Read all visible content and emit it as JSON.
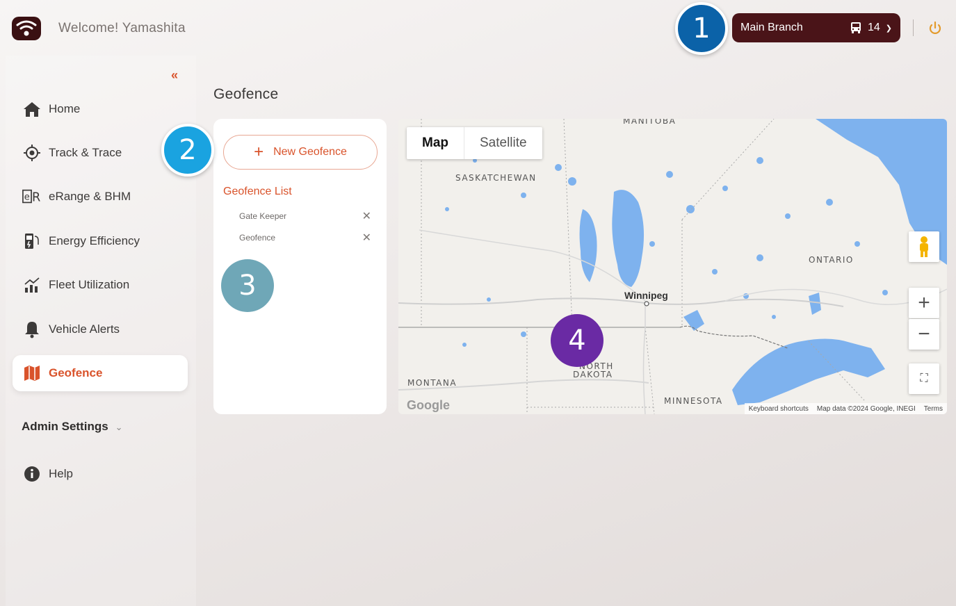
{
  "header": {
    "welcome": "Welcome! Yamashita",
    "branch": "Main Branch",
    "vehicle_count": "14"
  },
  "badges": [
    "1",
    "2",
    "3",
    "4"
  ],
  "sidebar": {
    "items": [
      {
        "label": "Home",
        "icon": "home-icon"
      },
      {
        "label": "Track & Trace",
        "icon": "crosshair-icon"
      },
      {
        "label": "eRange & BHM",
        "icon": "erange-icon"
      },
      {
        "label": "Energy Efficiency",
        "icon": "charger-icon"
      },
      {
        "label": "Fleet Utilization",
        "icon": "chart-icon"
      },
      {
        "label": "Vehicle Alerts",
        "icon": "bell-icon"
      },
      {
        "label": "Geofence",
        "icon": "map-icon",
        "active": true
      }
    ],
    "admin_settings": "Admin Settings",
    "help": "Help"
  },
  "main": {
    "title": "Geofence",
    "new_geofence": "New Geofence",
    "list_title": "Geofence List",
    "geofences": [
      "Gate Keeper",
      "Geofence"
    ]
  },
  "map": {
    "type_map": "Map",
    "type_satellite": "Satellite",
    "labels": {
      "manitoba": "MANITOBA",
      "saskatchewan": "SASKATCHEWAN",
      "ontario": "ONTARIO",
      "montana": "MONTANA",
      "north_dakota_1": "NORTH",
      "north_dakota_2": "DAKOTA",
      "minnesota": "MINNESOTA",
      "winnipeg": "Winnipeg"
    },
    "google": "Google",
    "shortcuts": "Keyboard shortcuts",
    "map_data": "Map data ©2024 Google, INEGI",
    "terms": "Terms"
  },
  "colors": {
    "accent": "#d9532b",
    "branch_bg": "#4a1418",
    "water": "#7eb2ee"
  }
}
